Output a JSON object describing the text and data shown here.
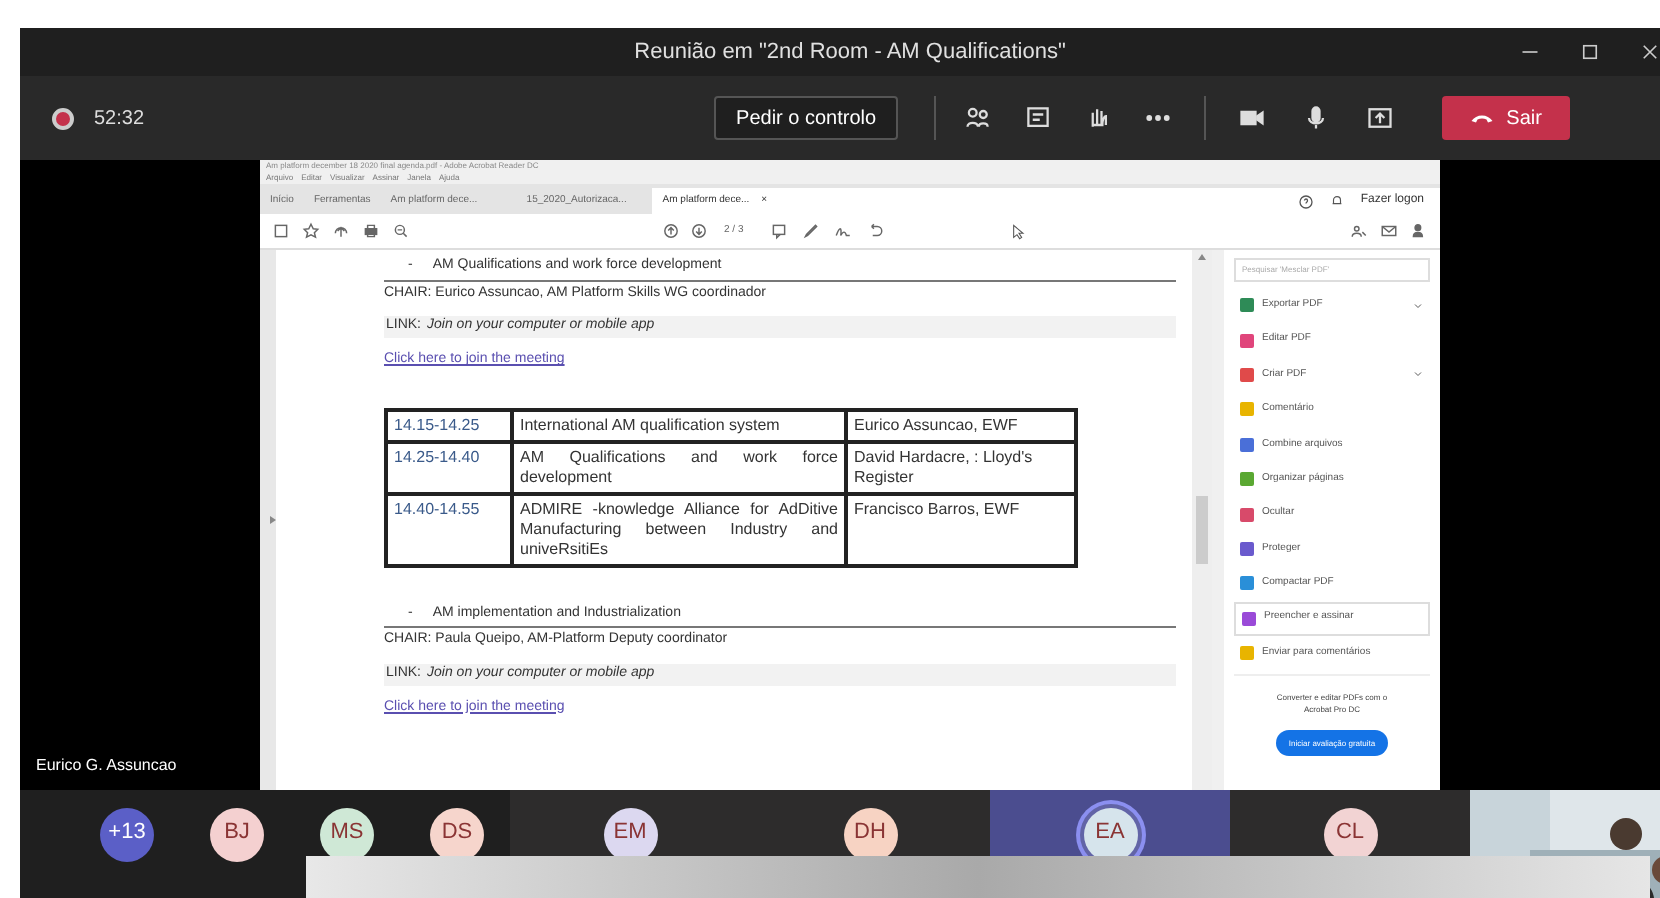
{
  "window": {
    "title": "Reunião em \"2nd Room - AM Qualifications\""
  },
  "call_bar": {
    "recording": true,
    "timer": "52:32",
    "request_control": "Pedir o controlo",
    "leave": "Sair"
  },
  "acrobat": {
    "title": "Am platform december 18 2020 final agenda.pdf - Adobe Acrobat Reader DC",
    "menu": [
      "Arquivo",
      "Editar",
      "Visualizar",
      "Assinar",
      "Janela",
      "Ajuda"
    ],
    "tabs": [
      {
        "label": "Início",
        "selected": false
      },
      {
        "label": "Ferramentas",
        "selected": false
      },
      {
        "label": "Am platform dece...",
        "selected": false
      },
      {
        "label": "15_2020_Autorizaca...",
        "selected": false
      },
      {
        "label": "Am platform dece...",
        "selected": true,
        "close": "×"
      }
    ],
    "page_indicator": "2 / 3",
    "login": "Fazer logon",
    "search": {
      "placeholder": "Pesquisar 'Mesclar PDF'"
    },
    "tools": [
      {
        "label": "Exportar PDF",
        "color": "#2e8b57",
        "expandable": true,
        "selected": false
      },
      {
        "label": "Editar PDF",
        "color": "#e0457b",
        "expandable": false,
        "selected": false
      },
      {
        "label": "Criar PDF",
        "color": "#e04a4a",
        "expandable": true,
        "selected": false
      },
      {
        "label": "Comentário",
        "color": "#e8b400",
        "expandable": false,
        "selected": false
      },
      {
        "label": "Combine arquivos",
        "color": "#4a6fd8",
        "expandable": false,
        "selected": false
      },
      {
        "label": "Organizar páginas",
        "color": "#5aa832",
        "expandable": false,
        "selected": false
      },
      {
        "label": "Ocultar",
        "color": "#d84a6a",
        "expandable": false,
        "selected": false
      },
      {
        "label": "Proteger",
        "color": "#6a5acd",
        "expandable": false,
        "selected": false
      },
      {
        "label": "Compactar PDF",
        "color": "#2a8fd8",
        "expandable": false,
        "selected": false
      },
      {
        "label": "Preencher e assinar",
        "color": "#9a4ad8",
        "expandable": false,
        "selected": true
      },
      {
        "label": "Enviar para comentários",
        "color": "#e8b400",
        "expandable": false,
        "selected": false
      }
    ],
    "promo": "Converter e editar PDFs com o Acrobat Pro DC",
    "promo_button": "Iniciar avaliação gratuita",
    "sections": [
      {
        "bullet": "-",
        "heading": "AM Qualifications and work force development",
        "chair": "CHAIR: Eurico Assuncao, AM Platform Skills WG coordinador",
        "link_label": "LINK:",
        "link_text": "Join on your computer or mobile app",
        "join": "Click here to join the meeting",
        "table": [
          [
            "14.15-14.25",
            "International AM qualification system",
            "Eurico Assuncao, EWF"
          ],
          [
            "14.25-14.40",
            "AM Qualifications and work force development",
            "David Hardacre, : Lloyd's Register"
          ],
          [
            "14.40-14.55",
            "ADMIRE -knowledge Alliance for AdDitive Manufacturing between Industry and univeRsitiEs",
            "Francisco Barros, EWF"
          ]
        ]
      },
      {
        "bullet": "-",
        "heading": "AM implementation and Industrialization",
        "chair": "CHAIR: Paula Queipo, AM-Platform Deputy coordinator",
        "link_label": "LINK:",
        "link_text": "Join on your computer or mobile app",
        "join": "Click here to join the meeting"
      }
    ]
  },
  "presenter": "Eurico G. Assuncao",
  "participants": [
    {
      "initials": "+13",
      "kind": "small",
      "color": "#5b5fc7",
      "speaking": false
    },
    {
      "initials": "BJ",
      "kind": "small",
      "color": "#f4d0d0",
      "speaking": false
    },
    {
      "initials": "MS",
      "kind": "small",
      "color": "#cfe8d6",
      "speaking": false
    },
    {
      "initials": "DS",
      "kind": "small",
      "color": "#f6d5cc",
      "speaking": false
    },
    {
      "initials": "EM",
      "kind": "tile",
      "color": "#dcd8f0",
      "speaking": false
    },
    {
      "initials": "DH",
      "kind": "tile",
      "color": "#f7d3c3",
      "speaking": false
    },
    {
      "initials": "EA",
      "kind": "tile",
      "color": "#d6e4ec",
      "speaking": true
    },
    {
      "initials": "CL",
      "kind": "tile",
      "color": "#f2d3d3",
      "speaking": false
    },
    {
      "kind": "camera"
    }
  ]
}
